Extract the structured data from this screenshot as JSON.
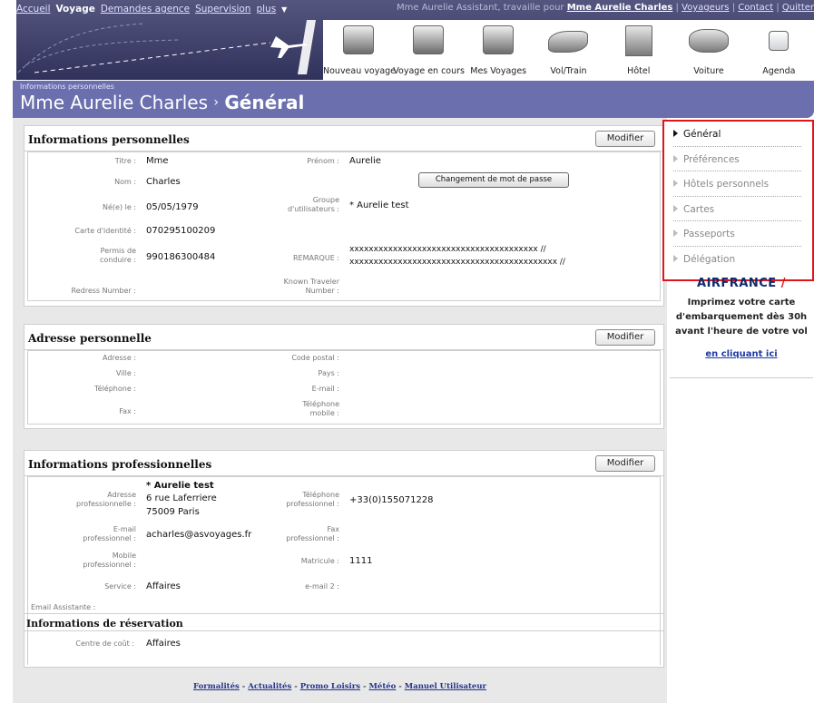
{
  "header": {
    "nav": [
      {
        "label": "Accueil"
      },
      {
        "label": "Voyage"
      },
      {
        "label": "Demandes agence"
      },
      {
        "label": "Supervision"
      },
      {
        "label": "plus"
      }
    ],
    "assistant_prefix": "Mme Aurelie Assistant, travaille pour",
    "assistant_for": "Mme Aurelie Charles",
    "links": [
      "Voyageurs",
      "Contact",
      "Quitter"
    ],
    "separator": "|",
    "icons": [
      {
        "label": "Nouveau voyage",
        "icon": "new-trip-suitcase-icon"
      },
      {
        "label": "Voyage en cours",
        "icon": "suitcase-icon"
      },
      {
        "label": "Mes Voyages",
        "icon": "luggage-stack-icon"
      },
      {
        "label": "Vol/Train",
        "icon": "plane-icon"
      },
      {
        "label": "Hôtel",
        "icon": "hotel-icon"
      },
      {
        "label": "Voiture",
        "icon": "car-icon"
      },
      {
        "label": "Agenda",
        "icon": "calendar-icon"
      }
    ]
  },
  "title": {
    "crumb": "Informations personnelles",
    "name": "Mme Aurelie Charles",
    "sep": "›",
    "section": "Général"
  },
  "perso": {
    "heading": "Informations personnelles",
    "modify": "Modifier",
    "titre_label": "Titre :",
    "titre": "Mme",
    "prenom_label": "Prénom :",
    "prenom": "Aurelie",
    "nom_label": "Nom :",
    "nom": "Charles",
    "password_button": "Changement de mot de passe",
    "naissance_label": "Né(e) le :",
    "naissance": "05/05/1979",
    "groupe_label_1": "Groupe",
    "groupe_label_2": "d'utilisateurs :",
    "groupe": "* Aurelie test",
    "carte_label": "Carte d'identité :",
    "carte": "070295100209",
    "permis_label_1": "Permis de",
    "permis_label_2": "conduire :",
    "permis": "990186300484",
    "remarque_label": "REMARQUE :",
    "remarque_1": "xxxxxxxxxxxxxxxxxxxxxxxxxxxxxxxxxxxxxxx //",
    "remarque_2": "xxxxxxxxxxxxxxxxxxxxxxxxxxxxxxxxxxxxxxxxxxx //",
    "redress_label": "Redress Number :",
    "ktn_label_1": "Known Traveler",
    "ktn_label_2": "Number :"
  },
  "adresse": {
    "heading": "Adresse personnelle",
    "modify": "Modifier",
    "adresse_label": "Adresse :",
    "cp_label": "Code postal :",
    "ville_label": "Ville :",
    "pays_label": "Pays :",
    "tel_label": "Téléphone :",
    "email_label": "E-mail :",
    "fax_label": "Fax :",
    "mobile_label_1": "Téléphone",
    "mobile_label_2": "mobile :"
  },
  "pro": {
    "heading": "Informations professionnelles",
    "modify": "Modifier",
    "adr_label_1": "Adresse",
    "adr_label_2": "professionnelle :",
    "adr_1": "* Aurelie test",
    "adr_2": "6 rue Laferriere",
    "adr_3": "75009 Paris",
    "tel_label_1": "Téléphone",
    "tel_label_2": "professionnel :",
    "tel": "+33(0)155071228",
    "email_label_1": "E-mail",
    "email_label_2": "professionnel :",
    "email": "acharles@asvoyages.fr",
    "fax_label_1": "Fax",
    "fax_label_2": "professionnel :",
    "mobile_label_1": "Mobile",
    "mobile_label_2": "professionnel :",
    "matricule_label": "Matricule :",
    "matricule": "1111",
    "service_label": "Service :",
    "service": "Affaires",
    "email2_label": "e-mail 2 :",
    "assist_label": "Email Assistante :",
    "resa_heading": "Informations de réservation",
    "cout_label": "Centre de coût :",
    "cout": "Affaires"
  },
  "footer": {
    "links": [
      "Formalités",
      "Actualités",
      "Promo Loisirs",
      "Météo",
      "Manuel Utilisateur"
    ],
    "dash": "-"
  },
  "side": {
    "items": [
      "Général",
      "Préférences",
      "Hôtels personnels",
      "Cartes",
      "Passeports",
      "Délégation"
    ]
  },
  "ad": {
    "logo": "AIRFRANCE",
    "line1": "Imprimez votre carte",
    "line2": "d'embarquement dès 30h",
    "line3": "avant l'heure de votre vol",
    "link": "en cliquant ici"
  },
  "colors": {
    "header": "#3d3f6e",
    "band": "#6b6fae",
    "highlight": "#e0141b"
  }
}
